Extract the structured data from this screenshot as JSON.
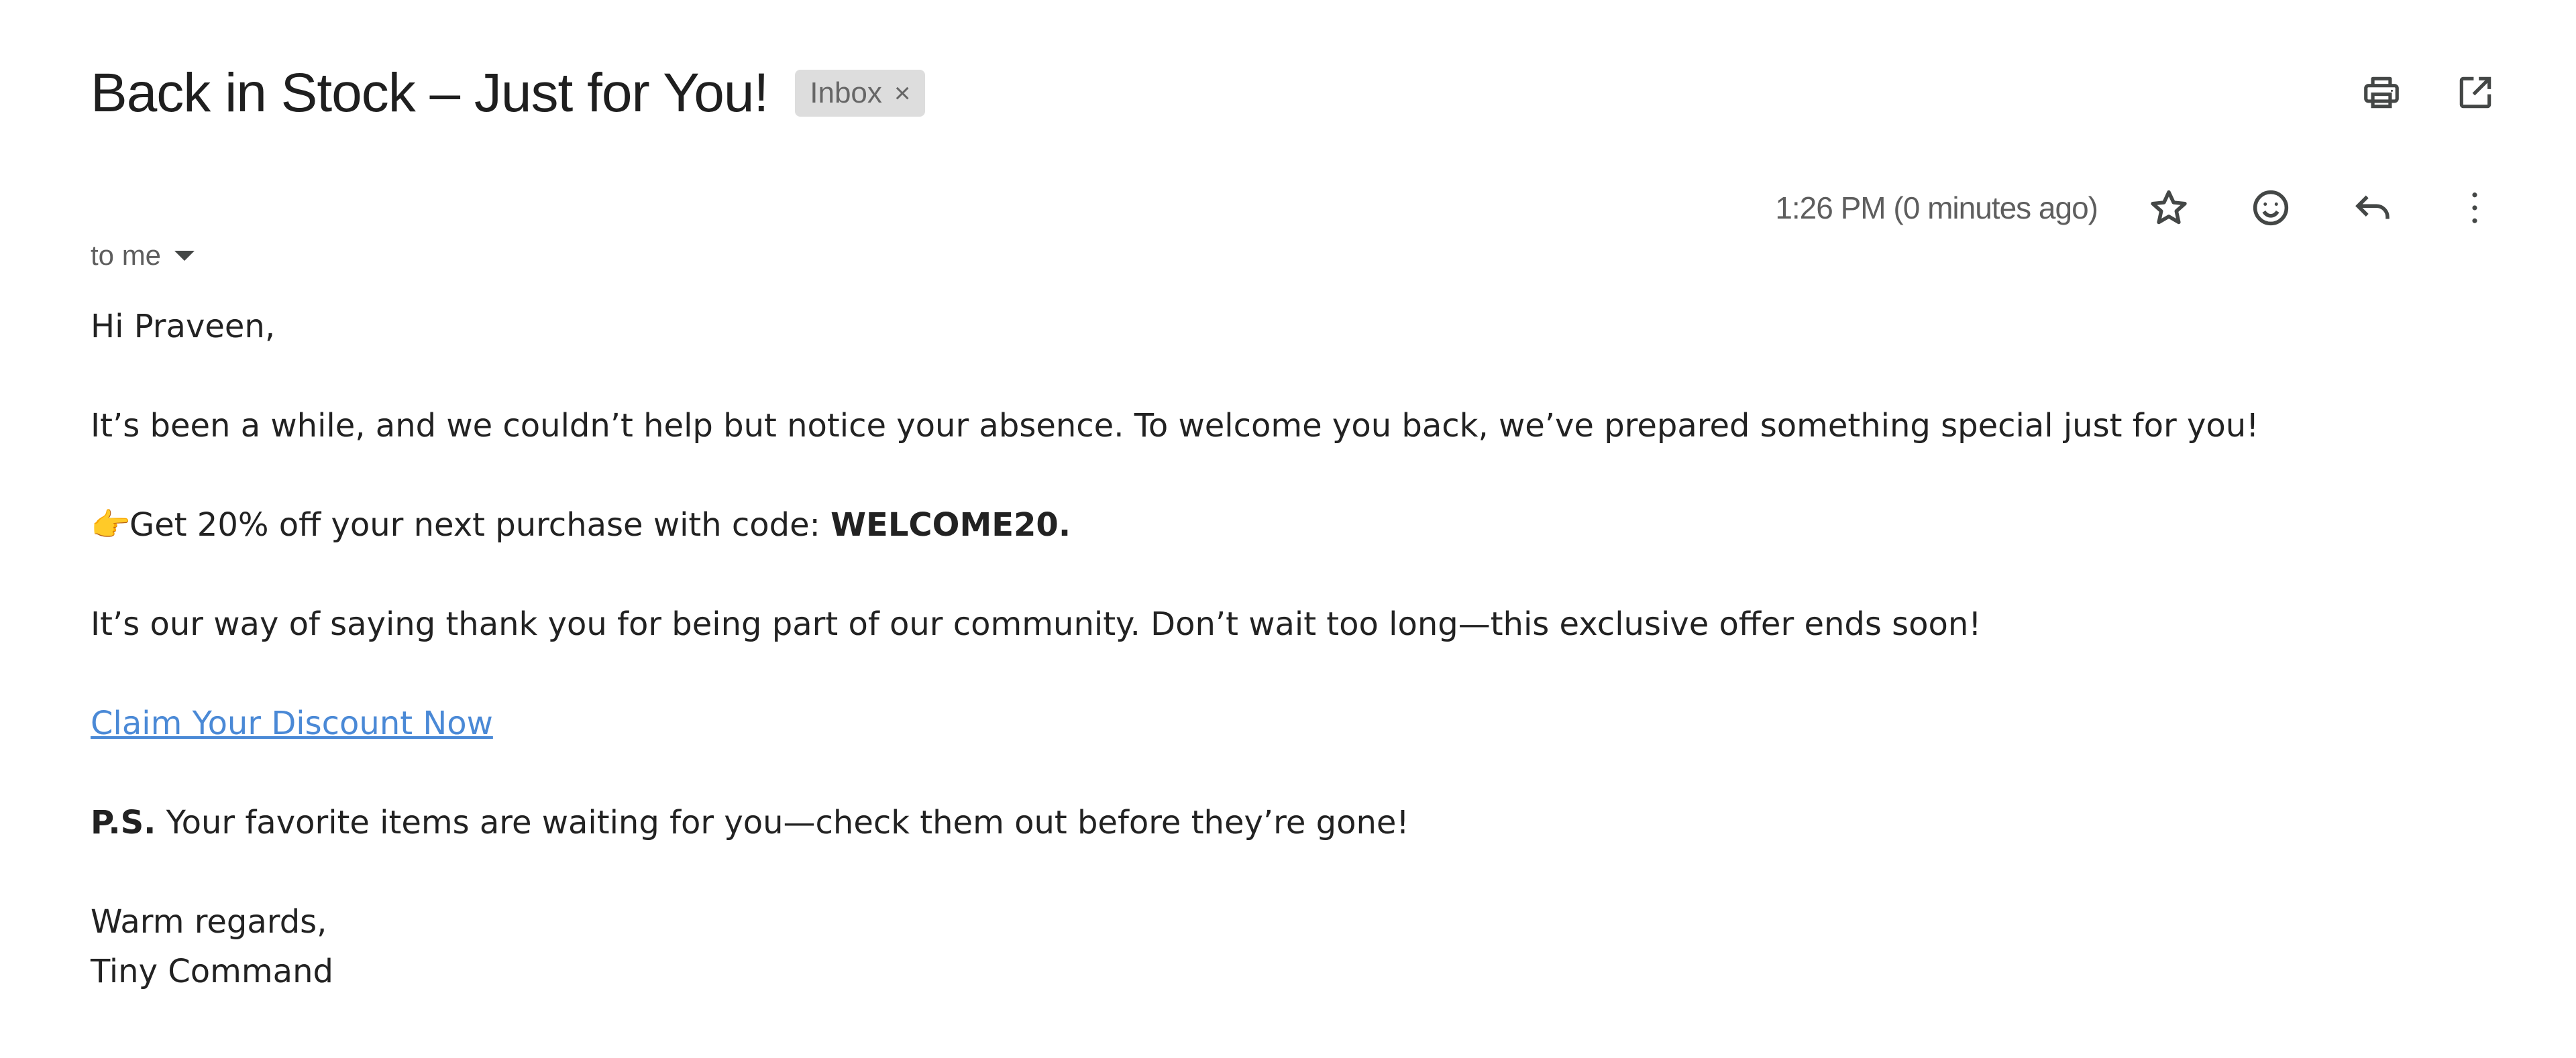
{
  "email": {
    "subject": "Back in Stock – Just for You!",
    "label": "Inbox",
    "label_remove": "×",
    "timestamp": "1:26 PM (0 minutes ago)",
    "recipient": "to me"
  },
  "toolbar": {
    "print_icon": "print-icon",
    "open_new_window_icon": "open-in-new-window-icon"
  },
  "actions": {
    "star_icon": "star-icon",
    "emoji_icon": "emoji-reaction-icon",
    "reply_icon": "reply-icon",
    "more_icon": "more-vertical-icon"
  },
  "body": {
    "greeting": "Hi Praveen,",
    "intro": "It’s been a while, and we couldn’t help but notice your absence. To welcome you back, we’ve prepared something special just for you!",
    "offer_emoji": "👉",
    "offer_text": "Get 20% off your next purchase with code: ",
    "offer_code": "WELCOME20.",
    "thanks": "It’s our way of saying thank you for being part of our community. Don’t wait too long—this exclusive offer ends soon!",
    "cta_link": "Claim Your Discount Now",
    "ps_label": "P.S.",
    "ps_text": " Your favorite items are waiting for you—check them out before they’re gone!",
    "signoff": "Warm regards,",
    "signature": "Tiny Command"
  },
  "colors": {
    "link": "#4a89d6",
    "chip_bg": "#dddddd",
    "icon": "#444746",
    "muted_text": "#5e5e5e"
  }
}
